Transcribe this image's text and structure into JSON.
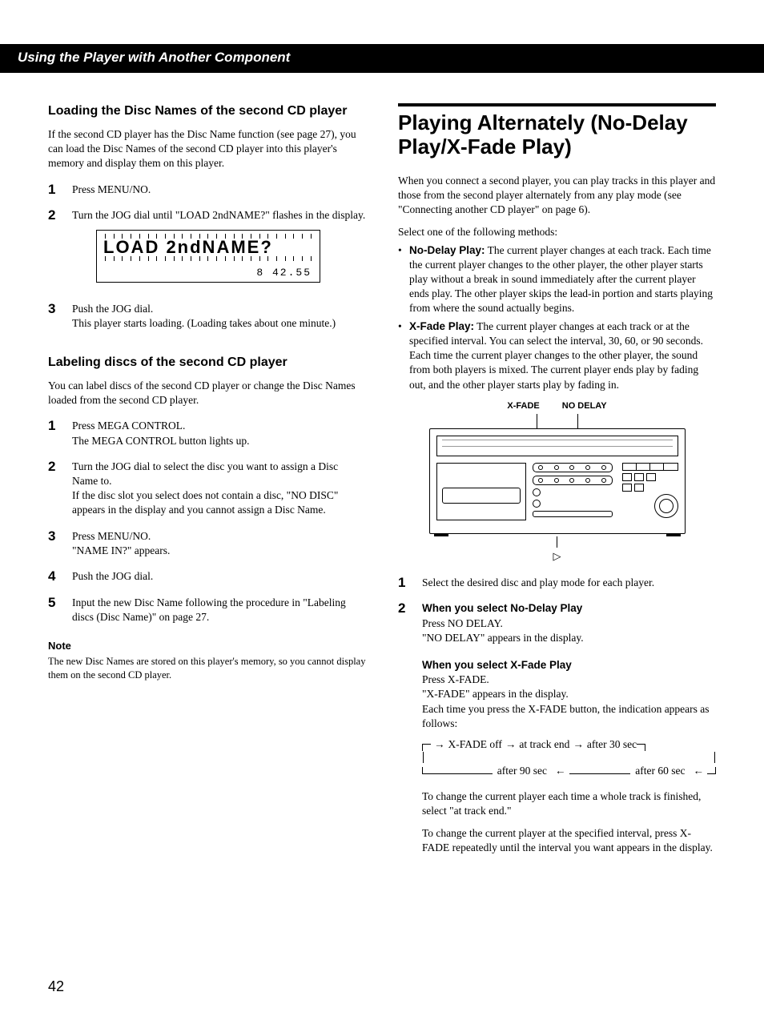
{
  "sectionBar": "Using the Player with Another Component",
  "pageNumber": "42",
  "left": {
    "h1": "Loading the Disc Names of the second CD player",
    "intro": "If the second CD player has the Disc Name function (see page 27), you can load the Disc Names of the second CD player into this player's memory and display them on this player.",
    "step1": "Press MENU/NO.",
    "step2": "Turn the JOG dial until \"LOAD 2ndNAME?\" flashes in the display.",
    "displayMain": "LOAD 2ndNAME?",
    "displaySub": "8  42.55",
    "step3a": "Push the JOG dial.",
    "step3b": "This player starts loading. (Loading takes about one minute.)",
    "h2": "Labeling discs of the second CD player",
    "intro2": "You can label discs of the second CD player or change the Disc Names loaded from the second CD player.",
    "s1a": "Press MEGA CONTROL.",
    "s1b": "The MEGA CONTROL button lights up.",
    "s2a": "Turn the JOG dial to select the disc you want to assign a Disc Name to.",
    "s2b": "If the disc slot you select does not contain a disc, \"NO DISC\" appears in the display and you cannot assign a Disc Name.",
    "s3a": "Press MENU/NO.",
    "s3b": "\"NAME IN?\" appears.",
    "s4": "Push the JOG dial.",
    "s5": "Input the new Disc Name following the procedure in \"Labeling discs (Disc Name)\" on page 27.",
    "noteH": "Note",
    "noteT": "The new Disc Names are stored on this player's memory, so you cannot display them on the second CD player."
  },
  "right": {
    "h1": "Playing Alternately (No-Delay Play/X-Fade Play)",
    "intro1": "When you connect a second player, you can play tracks in this player and those from the second player alternately from any play mode (see \"Connecting another CD player\" on page 6).",
    "intro2": "Select one of the following methods:",
    "bullet1Label": "No-Delay Play:",
    "bullet1": " The current player changes at each track. Each time the current player changes to the other player, the other player starts play without a break in sound immediately after the current player ends play. The other player skips the lead-in portion and starts playing from where the sound actually begins.",
    "bullet2Label": "X-Fade Play:",
    "bullet2": " The current player changes at each track or at the specified interval. You can select the interval, 30, 60, or 90 seconds. Each time the current player changes to the other player, the sound from both players is mixed. The current player ends play by fading out, and the other player starts play by fading in.",
    "label1": "X-FADE",
    "label2": "NO DELAY",
    "playGlyph": "▷",
    "step1": "Select the desired disc and play mode for each player.",
    "step2h1": "When you select No-Delay Play",
    "step2a": "Press NO DELAY.",
    "step2b": "\"NO DELAY\" appears in the display.",
    "step2h2": "When you select X-Fade Play",
    "step2c": "Press X-FADE.",
    "step2d": "\"X-FADE\" appears in the display.",
    "step2e": "Each time you press the X-FADE button, the indication appears as follows:",
    "cycle1": "X-FADE off",
    "cycle2": "at track end",
    "cycle3": "after 30 sec",
    "cycle4": "after 90 sec",
    "cycle5": "after 60 sec",
    "step2f": "To change the current player each time a whole track is finished, select \"at track end.\"",
    "step2g": "To change the current player at the specified interval, press X-FADE repeatedly until the interval you want appears in the display."
  }
}
